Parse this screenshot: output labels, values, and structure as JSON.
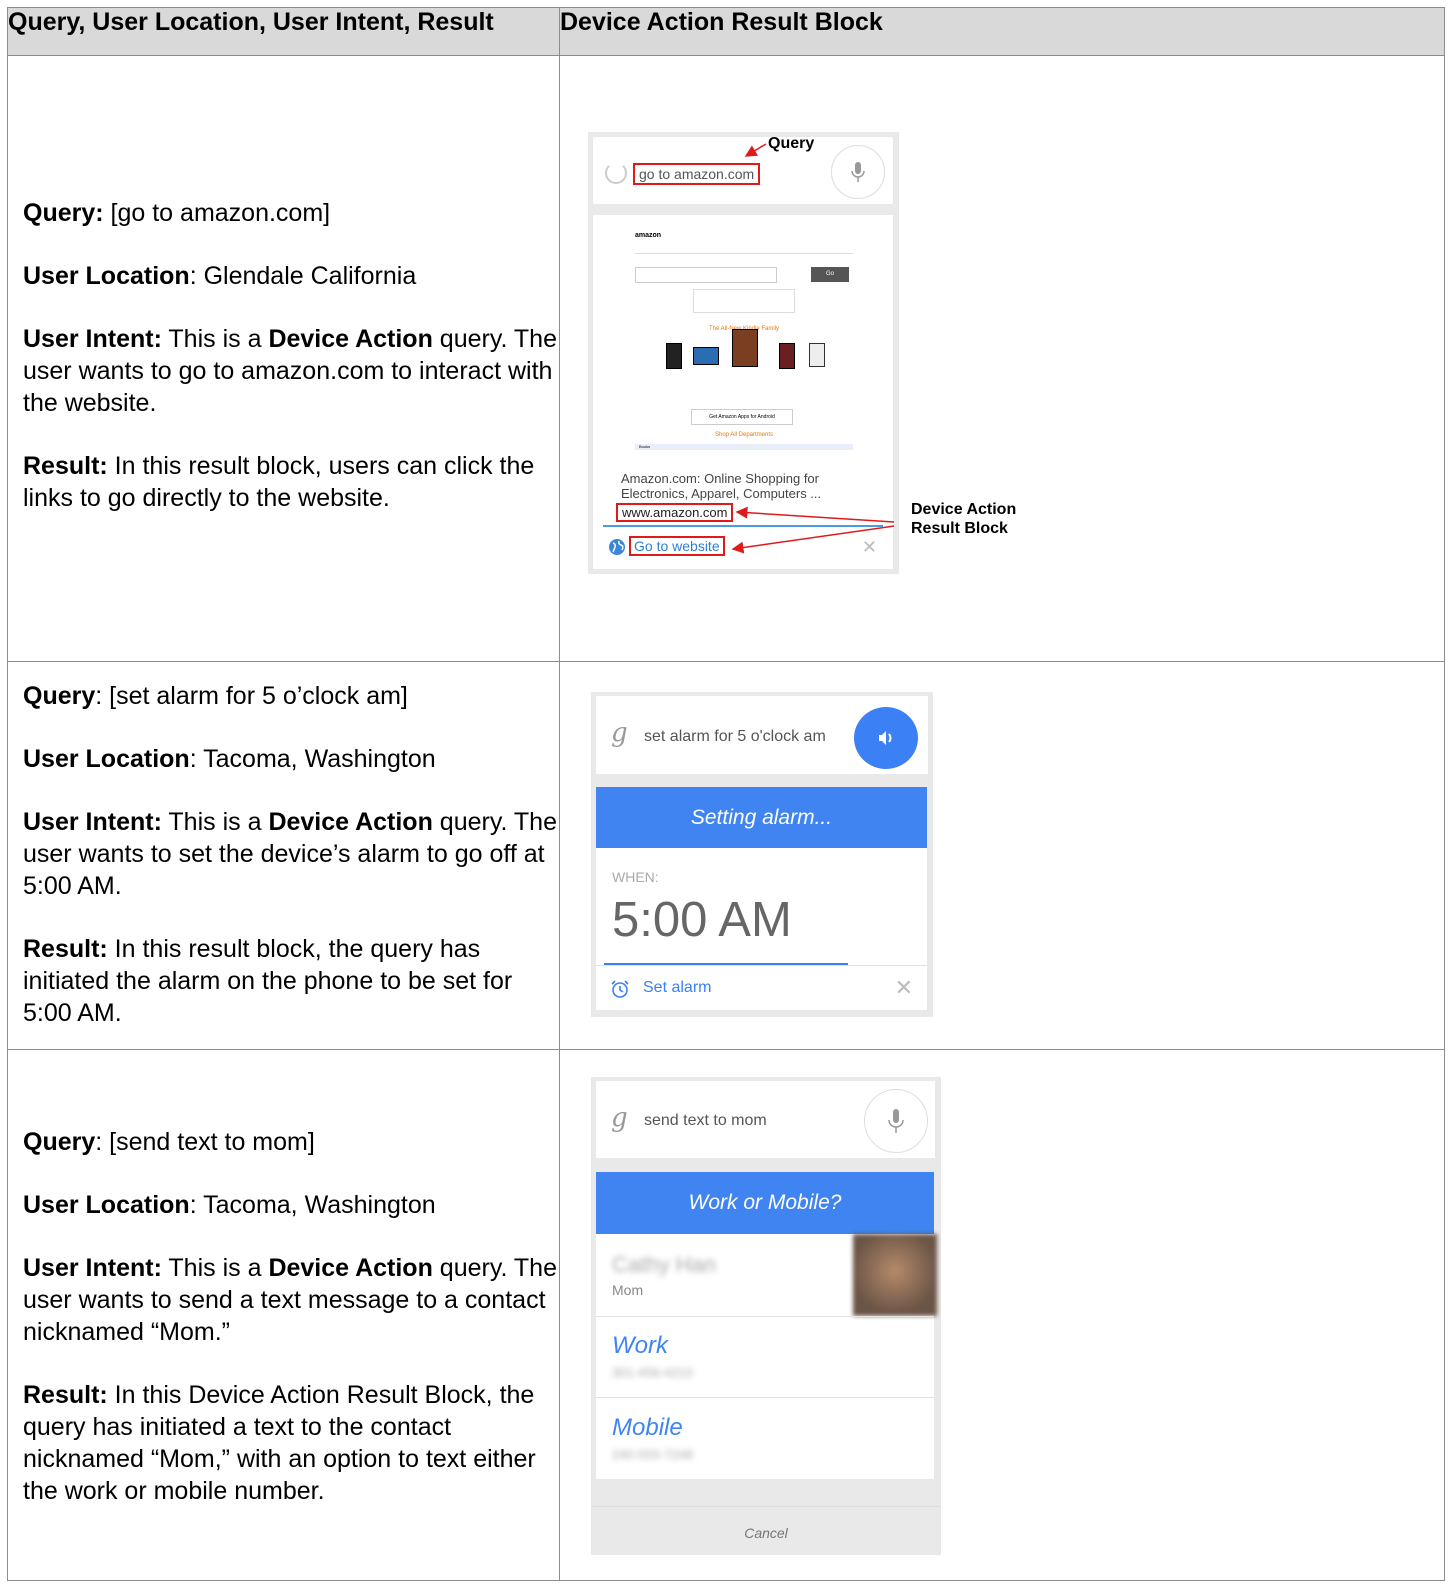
{
  "header": {
    "col1": "Query, User Location, User Intent, Result",
    "col2": "Device Action Result Block"
  },
  "rows": [
    {
      "query_label": "Query:",
      "query": " [go to amazon.com]",
      "location_label": "User Location",
      "location": ": Glendale California",
      "intent_label": "User Intent:",
      "intent_pre": " This is a ",
      "intent_bold": "Device Action",
      "intent_post": " query. The user wants to go to amazon.com to interact with the website.",
      "result_label": "Result:",
      "result": " In this result block, users can click the links to go directly to the website.",
      "mock": {
        "query_text": "go to amazon.com",
        "annotation_query": "Query",
        "annotation_block": "Device Action Result Block",
        "snippet": "Amazon.com: Online Shopping for Electronics, Apparel, Computers ...",
        "url": "www.amazon.com",
        "go_button": "Go to website",
        "amazon_logo": "amazon",
        "kindle_banner": "The All-New Kindle Family",
        "dept_link": "Shop All Departments",
        "apps_banner": "Get Amazon Apps for Android",
        "books_bar": "Books",
        "go_label": "Go"
      }
    },
    {
      "query_label": "Query",
      "query": ": [set alarm for 5 o’clock am]",
      "location_label": "User Location",
      "location": ": Tacoma, Washington",
      "intent_label": "User Intent:",
      "intent_pre": " This is a ",
      "intent_bold": "Device Action",
      "intent_post": " query. The user wants to set the device’s alarm to go off at 5:00 AM.",
      "result_label": "Result:",
      "result": " In this result block, the query has initiated the alarm on the phone to be set for 5:00 AM.",
      "mock": {
        "query_text": "set alarm for 5 o'clock am",
        "header": "Setting alarm...",
        "when_label": "WHEN:",
        "time": "5:00 AM",
        "action": "Set alarm"
      }
    },
    {
      "query_label": "Query",
      "query": ": [send text to mom]",
      "location_label": "User Location",
      "location": ": Tacoma, Washington",
      "intent_label": "User Intent:",
      "intent_pre": " This is a ",
      "intent_bold": "Device Action",
      "intent_post": " query. The user wants to send a text message to a contact nicknamed “Mom.”",
      "result_label": "Result:",
      "result": " In this Device Action Result Block, the query has initiated a text to the contact nicknamed “Mom,” with an option to text either the work or mobile number.",
      "mock": {
        "query_text": "send text to mom",
        "header": "Work or Mobile?",
        "contact_name": "Cathy Han",
        "contact_nick": "Mom",
        "option1": "Work",
        "option1_number": "301-456-4210",
        "option2": "Mobile",
        "option2_number": "240-555-7248",
        "cancel": "Cancel"
      }
    }
  ],
  "colors": {
    "annotation_red": "#e0191b",
    "google_blue": "#3f84f0",
    "header_gray": "#d9d9d9"
  },
  "icons": [
    "spinner-icon",
    "microphone-icon",
    "globe-icon",
    "close-icon",
    "google-g-icon",
    "speaker-icon",
    "alarm-clock-icon"
  ]
}
